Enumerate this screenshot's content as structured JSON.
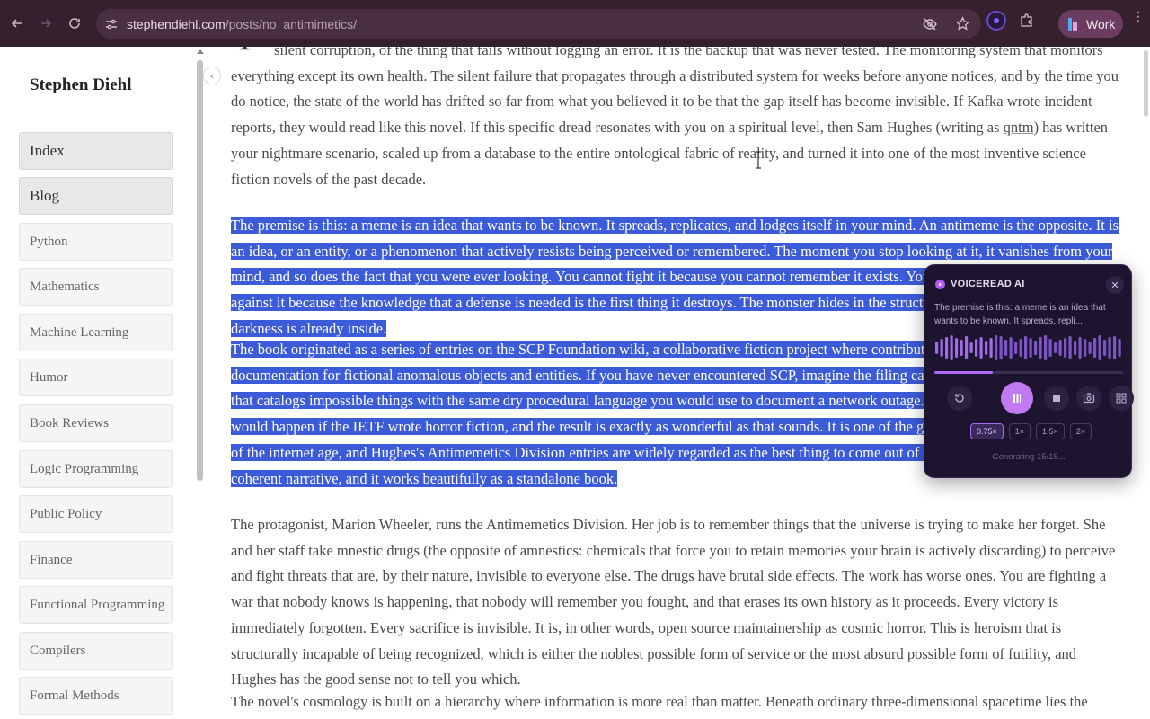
{
  "browser": {
    "url_host": "stephendiehl.com",
    "url_path": "/posts/no_antimimetics/",
    "profile_label": "Work",
    "icons": [
      "back-icon",
      "forward-icon",
      "reload-icon",
      "site-info-icon",
      "eye-off-icon",
      "star-icon",
      "extension-icon",
      "puzzle-icon",
      "menu-icon"
    ]
  },
  "sidebar": {
    "title": "Stephen Diehl",
    "primary": [
      "Index",
      "Blog"
    ],
    "items": [
      "Python",
      "Mathematics",
      "Machine Learning",
      "Humor",
      "Book Reviews",
      "Logic Programming",
      "Public Policy",
      "Finance",
      "Functional Programming",
      "Compilers",
      "Formal Methods"
    ]
  },
  "article": {
    "dropcap": "I",
    "p1": "silent corruption, of the thing that fails without logging an error. It is the backup that was never tested. The monitoring system that monitors everything except its own health. The silent failure that propagates through a distributed system for weeks before anyone notices, and by the time you do notice, the state of the world has drifted so far from what you believed it to be that the gap itself has become invisible. If Kafka wrote incident reports, they would read like this novel. If this specific dread resonates with you on a spiritual level, then Sam Hughes (writing as",
    "p1_link": "qntm",
    "p1_tail": ") has written your nightmare scenario, scaled up from a database to the entire ontological fabric of reality, and turned it into one of the most inventive science fiction novels of the past decade.",
    "p2": "The premise is this: a meme is an idea that wants to be known. It spreads, replicates, and lodges itself in your mind. An antimeme is the opposite. It is an idea, or an entity, or a phenomenon that actively resists being perceived or remembered. The moment you stop looking at it, it vanishes from your mind, and so does the fact that you were ever looking. You cannot fight it because you cannot remember it exists. You cannot organize a defense against it because the knowledge that a defense is needed is the first thing it destroys. The monster hides in the structure of cognition itself. The darkness is already inside.",
    "p3": "The book originated as a series of entries on the SCP Foundation wiki, a collaborative fiction project where contributors write clinical, bureaucratic documentation for fictional anomalous objects and entities. If you have never encountered SCP, imagine the filing cabinet of a government agency that catalogs impossible things with the same dry procedural language you would use to document a network outage. The SCP Foundation is what would happen if the IETF wrote horror fiction, and the result is exactly as wonderful as that sounds. It is one of the genuinely great creative projects of the internet age, and Hughes's Antimemetics Division entries are widely regarded as the best thing to come out of it. The novel stitches them into a coherent narrative, and it works beautifully as a standalone book.",
    "p4": "The protagonist, Marion Wheeler, runs the Antimemetics Division. Her job is to remember things that the universe is trying to make her forget. She and her staff take mnestic drugs (the opposite of amnestics: chemicals that force you to retain memories your brain is actively discarding) to perceive and fight threats that are, by their nature, invisible to everyone else. The drugs have brutal side effects. The work has worse ones. You are fighting a war that nobody knows is happening, that nobody will remember you fought, and that erases its own history as it proceeds. Every victory is immediately forgotten. Every sacrifice is invisible. It is, in other words, open source maintainership as cosmic horror. This is heroism that is structurally incapable of being recognized, which is either the noblest possible form of service or the most absurd possible form of futility, and Hughes has the good sense not to tell you which.",
    "p5": "The novel's cosmology is built on a hierarchy where information is more real than matter. Beneath ordinary three-dimensional spacetime lies the noosphere:"
  },
  "voiceread": {
    "title": "VOICEREAD AI",
    "preview": "The premise is this: a meme is an idea that wants to be known. It spreads, repli...",
    "progress": 0.31,
    "speeds": [
      "0.75×",
      "1×",
      "1.5×",
      "2×"
    ],
    "active_speed": "0.75×",
    "status": "Generating 15/15...",
    "accent": "#c27af3",
    "icons": [
      "voiceread-logo-icon",
      "close-icon",
      "replay-icon",
      "pause-icon",
      "stop-icon",
      "camera-icon",
      "grid-icon"
    ]
  },
  "colors": {
    "chrome_bg": "#35202e",
    "selection": "#3b5bd9",
    "body_text": "#4a4a4a"
  }
}
